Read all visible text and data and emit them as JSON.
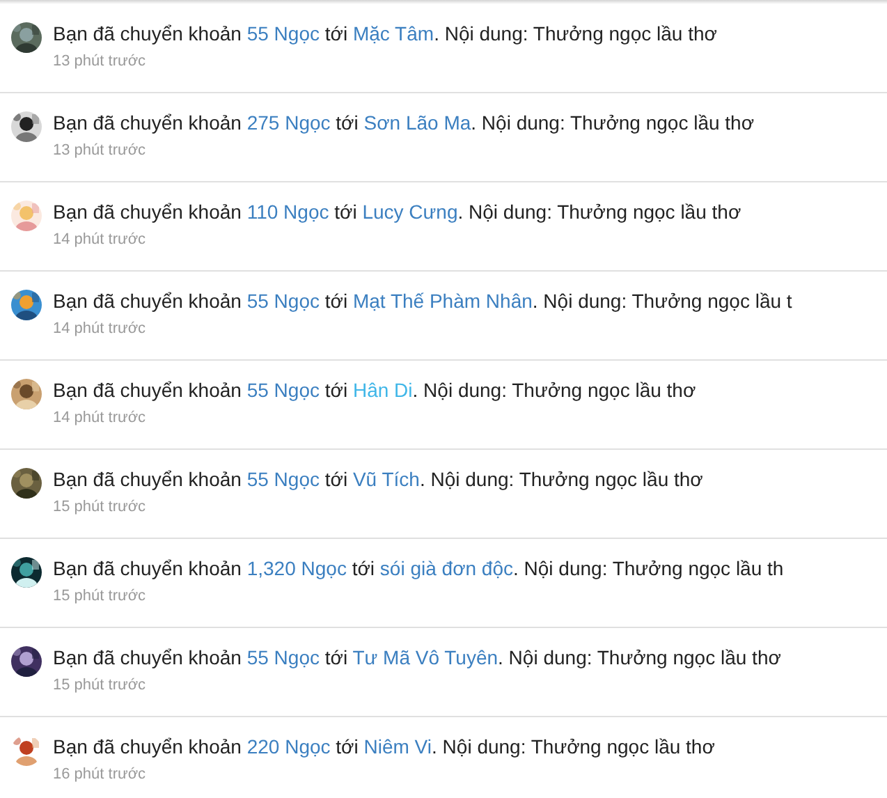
{
  "notifications": [
    {
      "prefix": "Bạn đã chuyển khoản",
      "amount": "55 Ngọc",
      "joiner": "tới",
      "recipient": "Mặc Tâm",
      "recipient_highlighted": false,
      "note": ". Nội dung: Thưởng ngọc lầu thơ",
      "time": "13 phút trước"
    },
    {
      "prefix": "Bạn đã chuyển khoản",
      "amount": "275 Ngọc",
      "joiner": "tới",
      "recipient": "Sơn Lão Ma",
      "recipient_highlighted": false,
      "note": ". Nội dung: Thưởng ngọc lầu thơ",
      "time": "13 phút trước"
    },
    {
      "prefix": "Bạn đã chuyển khoản",
      "amount": "110 Ngọc",
      "joiner": "tới",
      "recipient": "Lucy Cưng",
      "recipient_highlighted": false,
      "note": ". Nội dung: Thưởng ngọc lầu thơ",
      "time": "14 phút trước"
    },
    {
      "prefix": "Bạn đã chuyển khoản",
      "amount": "55 Ngọc",
      "joiner": "tới",
      "recipient": "Mạt Thế Phàm Nhân",
      "recipient_highlighted": false,
      "note": ". Nội dung: Thưởng ngọc lầu t",
      "time": "14 phút trước"
    },
    {
      "prefix": "Bạn đã chuyển khoản",
      "amount": "55 Ngọc",
      "joiner": "tới",
      "recipient": "Hân Di",
      "recipient_highlighted": true,
      "note": ". Nội dung: Thưởng ngọc lầu thơ",
      "time": "14 phút trước"
    },
    {
      "prefix": "Bạn đã chuyển khoản",
      "amount": "55 Ngọc",
      "joiner": "tới",
      "recipient": "Vũ Tích",
      "recipient_highlighted": false,
      "note": ". Nội dung: Thưởng ngọc lầu thơ",
      "time": "15 phút trước"
    },
    {
      "prefix": "Bạn đã chuyển khoản",
      "amount": "1,320 Ngọc",
      "joiner": "tới",
      "recipient": "sói già đơn độc",
      "recipient_highlighted": false,
      "note": ". Nội dung: Thưởng ngọc lầu th",
      "time": "15 phút trước"
    },
    {
      "prefix": "Bạn đã chuyển khoản",
      "amount": "55 Ngọc",
      "joiner": "tới",
      "recipient": "Tư Mã Vô Tuyên",
      "recipient_highlighted": false,
      "note": ". Nội dung: Thưởng ngọc lầu thơ",
      "time": "15 phút trước"
    },
    {
      "prefix": "Bạn đã chuyển khoản",
      "amount": "220 Ngọc",
      "joiner": "tới",
      "recipient": "Niêm Vi",
      "recipient_highlighted": false,
      "note": ". Nội dung: Thưởng ngọc lầu thơ",
      "time": "16 phút trước"
    }
  ]
}
